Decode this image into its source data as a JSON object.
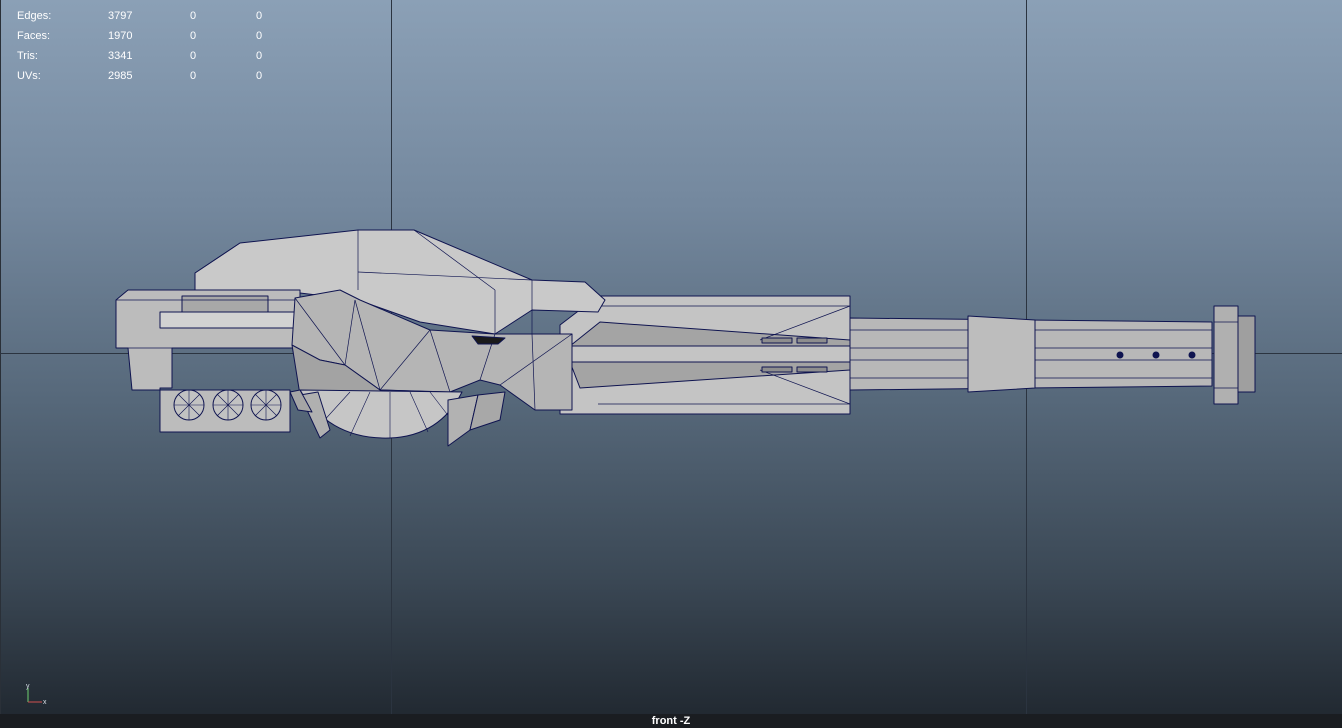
{
  "hud": {
    "rows": [
      {
        "label": "Edges:",
        "v1": "3797",
        "v2": "0",
        "v3": "0"
      },
      {
        "label": "Faces:",
        "v1": "1970",
        "v2": "0",
        "v3": "0"
      },
      {
        "label": "Tris:",
        "v1": "3341",
        "v2": "0",
        "v3": "0"
      },
      {
        "label": "UVs:",
        "v1": "2985",
        "v2": "0",
        "v3": "0"
      }
    ]
  },
  "gizmo": {
    "y_label": "y",
    "x_label": "x"
  },
  "viewport": {
    "camera_label": "front -Z",
    "colors": {
      "grid": "#2b3440",
      "wire": "#0f1450",
      "mesh_light": "#c9c9c9",
      "mesh_mid": "#a9a9a9",
      "mesh_dark": "#8e8e8e"
    }
  }
}
